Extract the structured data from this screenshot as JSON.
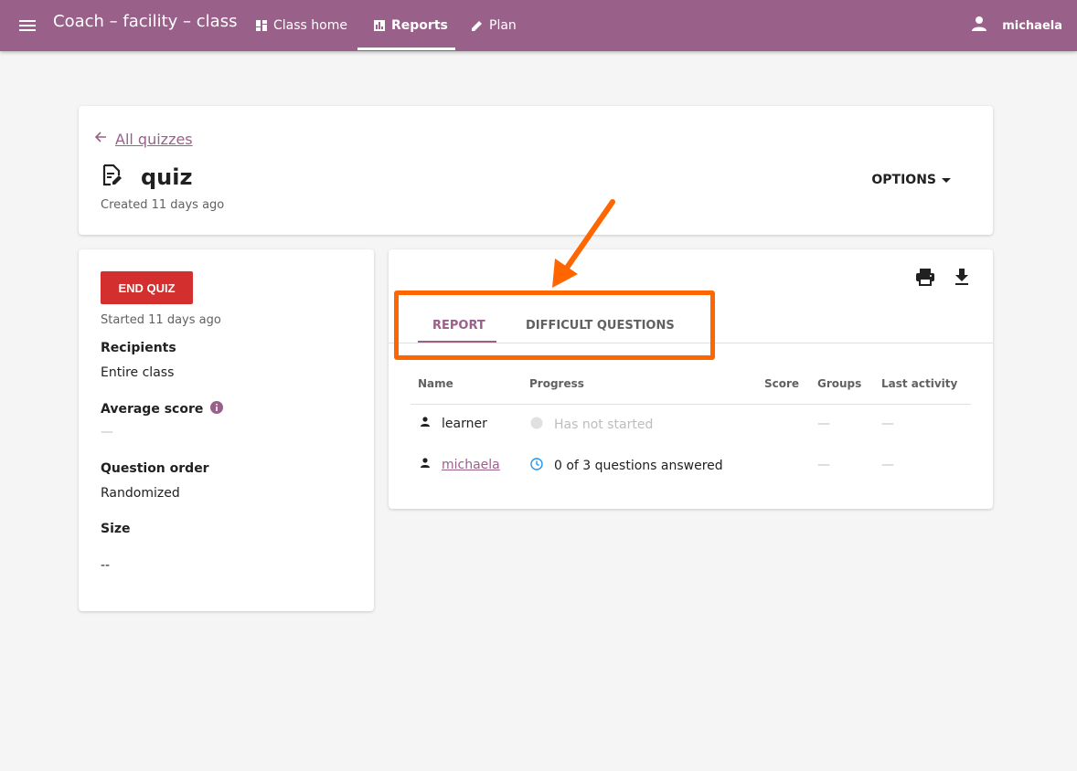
{
  "appbar": {
    "title": "Coach – facility – class",
    "nav": [
      {
        "label": "Class home",
        "icon": "dashboard-icon"
      },
      {
        "label": "Reports",
        "icon": "bar-chart-icon",
        "active": true
      },
      {
        "label": "Plan",
        "icon": "pencil-icon"
      }
    ],
    "username": "michaela",
    "color": "#996189"
  },
  "header": {
    "back_label": "All quizzes",
    "quiz_title": "quiz",
    "created": "Created 11 days ago",
    "options_label": "OPTIONS"
  },
  "sidebar": {
    "end_button": "END QUIZ",
    "started": "Started 11 days ago",
    "recipients_label": "Recipients",
    "recipients_value": "Entire class",
    "average_label": "Average score",
    "average_value": "—",
    "order_label": "Question order",
    "order_value": "Randomized",
    "size_label": "Size",
    "size_value": "--"
  },
  "report": {
    "tabs": [
      "REPORT",
      "DIFFICULT QUESTIONS"
    ],
    "columns": [
      "Name",
      "Progress",
      "Score",
      "Groups",
      "Last activity"
    ],
    "rows": [
      {
        "name": "learner",
        "progress": "Has not started",
        "score": "",
        "groups": "—",
        "last_activity": "—",
        "status": "not-started"
      },
      {
        "name": "michaela",
        "progress": "0 of 3 questions answered",
        "score": "",
        "groups": "—",
        "last_activity": "—",
        "status": "in-progress"
      }
    ]
  },
  "colors": {
    "accent": "#996189",
    "danger": "#d32f2f",
    "annotation": "#ff6600"
  }
}
